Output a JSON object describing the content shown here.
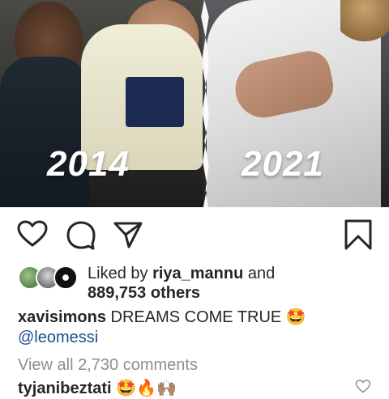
{
  "post": {
    "image": {
      "year_left": "2014",
      "year_right": "2021"
    },
    "actions": {
      "like": "heart-icon",
      "comment": "comment-bubble-icon",
      "share": "paper-plane-icon",
      "save": "bookmark-icon"
    },
    "likes": {
      "prefix": "Liked by ",
      "user": "riya_mannu",
      "connector": " and",
      "count": "889,753 others"
    },
    "caption": {
      "username": "xavisimons",
      "text": " DREAMS COME TRUE ",
      "emoji": "🤩",
      "mention": "@leomessi"
    },
    "comments": {
      "view_all": "View all 2,730 comments",
      "first_user": "tyjanibeztati",
      "first_emojis": "🤩🔥🙌🏽"
    }
  },
  "colors": {
    "text": "#262626",
    "muted": "#8e8e8e",
    "mention": "#1d4f91",
    "background": "#ffffff"
  }
}
